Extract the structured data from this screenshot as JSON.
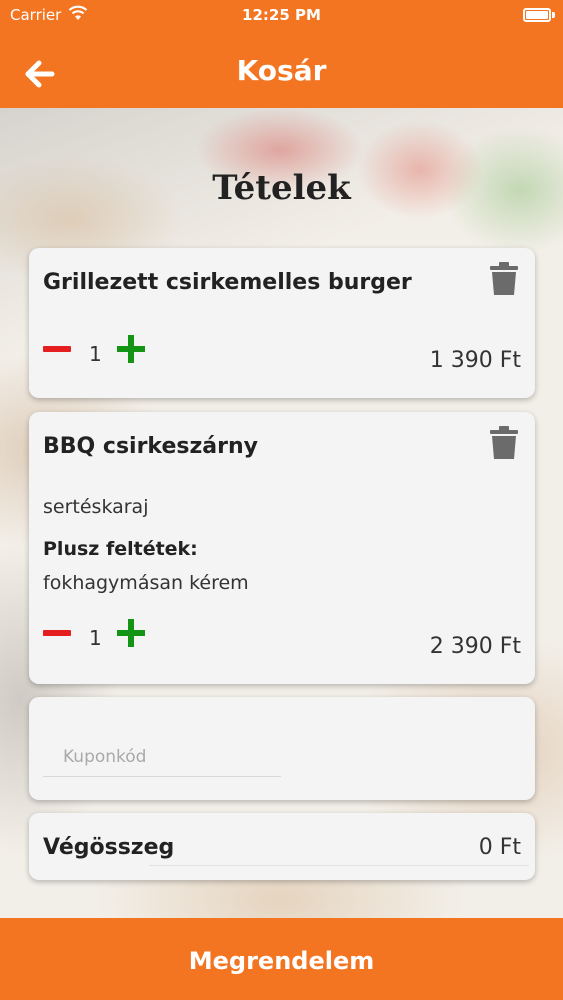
{
  "status_bar": {
    "carrier": "Carrier",
    "time": "12:25 PM"
  },
  "header": {
    "title": "Kosár",
    "back_icon": "arrow-left-icon"
  },
  "section_title": "Tételek",
  "items": [
    {
      "name": "Grillezett csirkemelles burger",
      "quantity": "1",
      "price": "1 390 Ft"
    },
    {
      "name": "BBQ csirkeszárny",
      "option": "sertéskaraj",
      "extras_label": "Plusz feltétek:",
      "extras": "fokhagymásan kérem",
      "quantity": "1",
      "price": "2 390 Ft"
    }
  ],
  "coupon": {
    "placeholder": "Kuponkód",
    "value": ""
  },
  "total": {
    "label": "Végösszeg",
    "value": "0 Ft"
  },
  "order_button": {
    "label": "Megrendelem"
  },
  "colors": {
    "accent": "#f37521",
    "minus": "#e41e1e",
    "plus": "#149414",
    "trash": "#6b6b6b"
  }
}
